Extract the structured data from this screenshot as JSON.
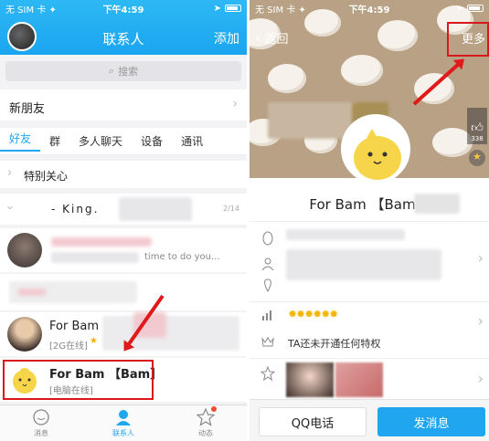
{
  "left": {
    "status": {
      "carrier": "无 SIM 卡 ✦",
      "time": "下午4:59"
    },
    "header": {
      "title": "联系人",
      "add_label": "添加"
    },
    "search_placeholder": "搜索",
    "new_friends": "新朋友",
    "tabs": [
      "好友",
      "群",
      "多人聊天",
      "设备",
      "通讯"
    ],
    "special": "特别关心",
    "group_king": "- King.",
    "group_king_suffix": "2/14",
    "contact_snippet": "time to do you...",
    "contacts": [
      {
        "name": "For Bam",
        "status": "[2G在线]"
      },
      {
        "name": "For Bam 【Bam】",
        "status": "[电脑在线]"
      }
    ],
    "nav": [
      "消息",
      "联系人",
      "动态"
    ]
  },
  "right": {
    "status": {
      "carrier": "无 SIM 卡 ✦",
      "time": "下午4:59"
    },
    "back_label": "返回",
    "more_label": "更多",
    "likes": "338",
    "profile_name": "For Bam 【Bam】",
    "vip_text": "TA还未开通任何特权",
    "btn_call": "QQ电话",
    "btn_msg": "发消息"
  },
  "colors": {
    "accent": "#1fa7ef",
    "highlight": "#d7191c",
    "send": "#20a6ee"
  }
}
